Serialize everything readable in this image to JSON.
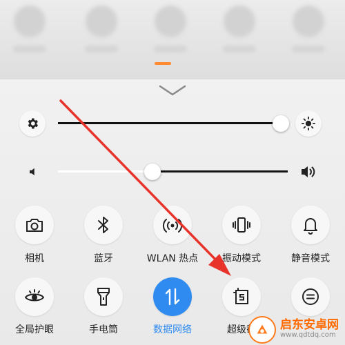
{
  "colors": {
    "accent": "#2f8bf0",
    "arrow": "#e8332a",
    "slider_fill": "#111111",
    "slider_empty": "#ffffff"
  },
  "brightness": {
    "level": 0.97,
    "left_icon": "gear-icon",
    "right_icon": "sun-icon"
  },
  "volume": {
    "level": 0.41,
    "left_icon": "speaker-low-icon",
    "right_icon": "speaker-high-icon"
  },
  "toggles": {
    "camera": {
      "label": "相机",
      "icon": "camera-icon"
    },
    "bluetooth": {
      "label": "蓝牙",
      "icon": "bluetooth-icon"
    },
    "wlan_hotspot": {
      "label": "WLAN 热点",
      "icon": "hotspot-icon"
    },
    "vibrate": {
      "label": "振动模式",
      "icon": "vibrate-icon"
    },
    "silent": {
      "label": "静音模式",
      "icon": "bell-icon"
    },
    "eye_care": {
      "label": "全局护眼",
      "icon": "eye-icon"
    },
    "flashlight": {
      "label": "手电筒",
      "icon": "flashlight-icon"
    },
    "mobile_data": {
      "label": "数据网络",
      "icon": "data-arrows-icon",
      "active": true
    },
    "super_screenshot": {
      "label": "超级截",
      "icon": "screenshot-icon"
    },
    "more": {
      "label": "",
      "icon": "menu-circle-icon"
    }
  },
  "watermark": {
    "title": "启东安卓网",
    "url": "www.qdtdq.com"
  }
}
